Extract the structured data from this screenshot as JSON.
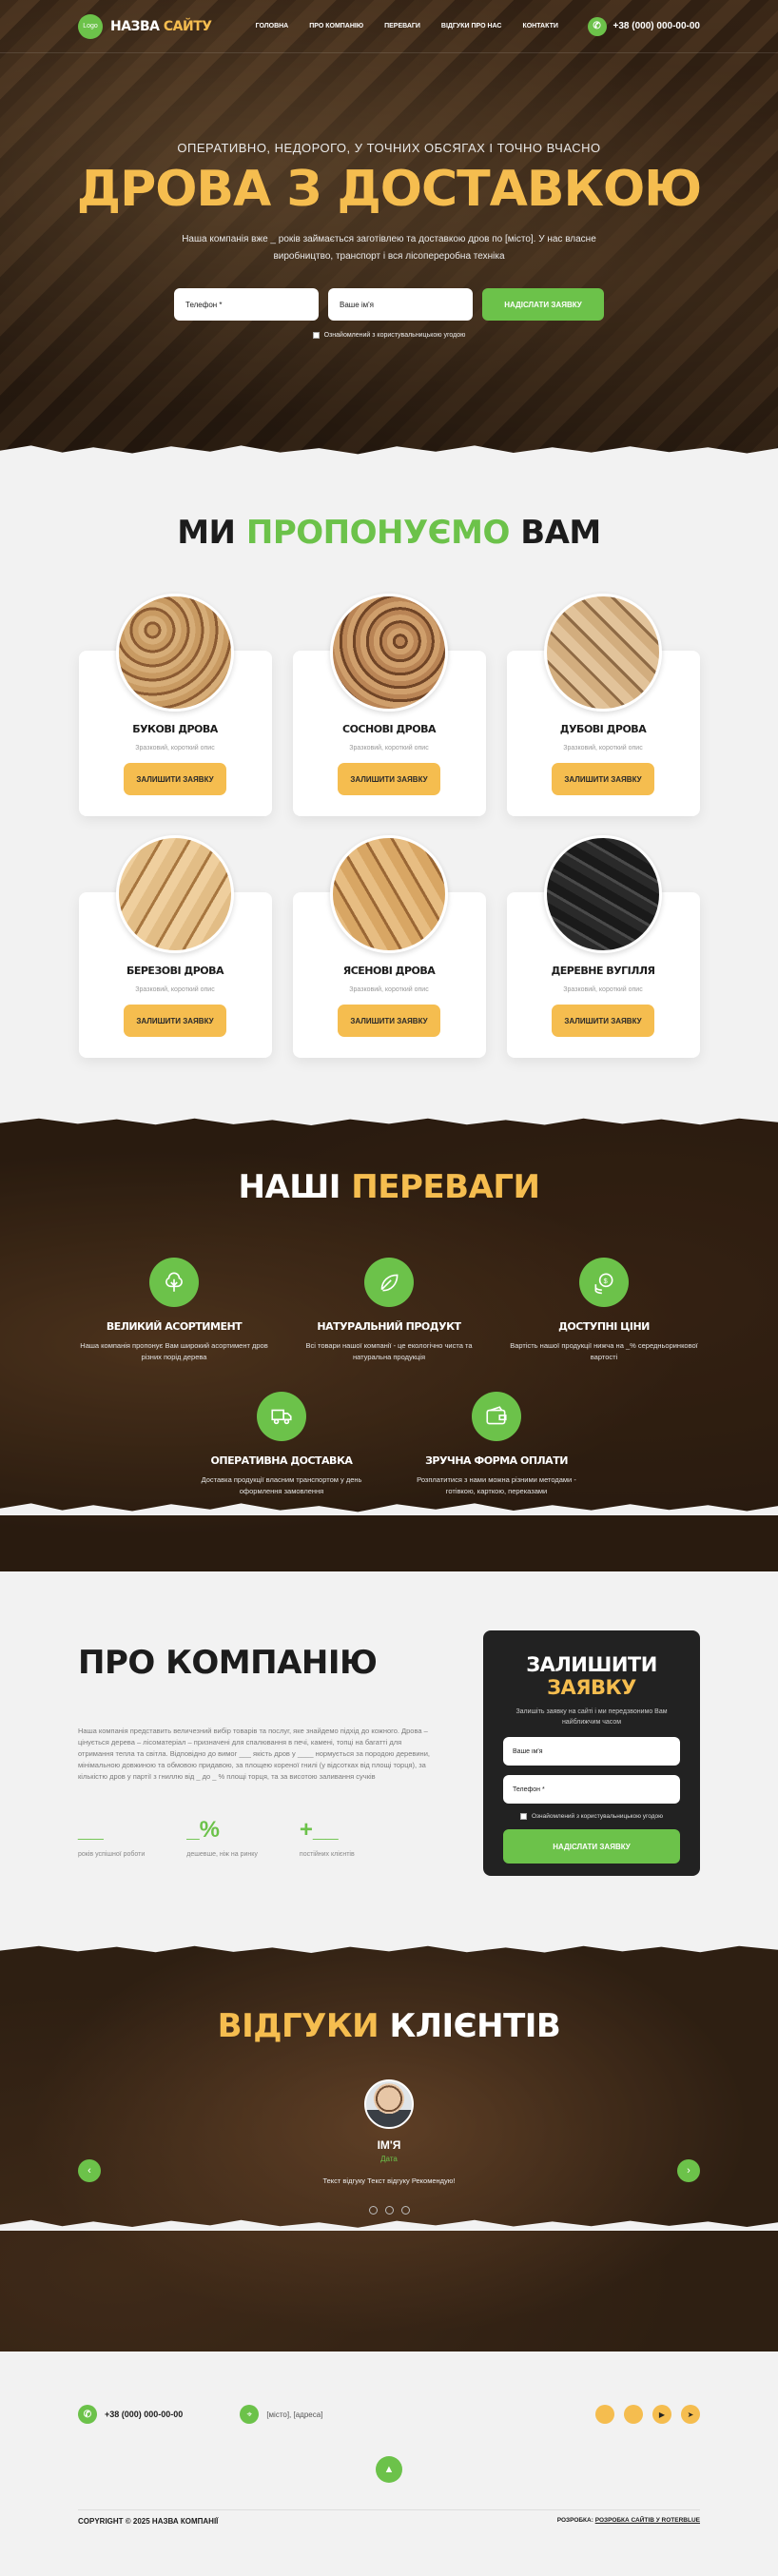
{
  "header": {
    "logo_text": "Logo",
    "site_name_1": "НАЗВА",
    "site_name_2": "САЙТУ",
    "menu": [
      "ГОЛОВНА",
      "ПРО КОМПАНІЮ",
      "ПЕРЕВАГИ",
      "ВІДГУКИ ПРО НАС",
      "КОНТАКТИ"
    ],
    "phone": "+38 (000) 000-00-00"
  },
  "hero": {
    "subtitle": "ОПЕРАТИВНО, НЕДОРОГО, У ТОЧНИХ ОБСЯГАХ І ТОЧНО ВЧАСНО",
    "title": "ДРОВА З ДОСТАВКОЮ",
    "text": "Наша компанія вже _ років займається заготівлею та доставкою дров по [місто]. У нас власне виробництво, транспорт і вся лісопереробна техніка",
    "phone_placeholder": "Телефон *",
    "name_placeholder": "Ваше ім'я",
    "submit": "НАДІСЛАТИ ЗАЯВКУ",
    "consent": "Ознайомлений з користувальницькою угодою"
  },
  "products": {
    "title_1": "МИ",
    "title_2": "ПРОПОНУЄМО",
    "title_3": "ВАМ",
    "items": [
      {
        "name": "БУКОВІ ДРОВА",
        "desc": "Зразковий, короткий опис",
        "button": "ЗАЛИШИТИ ЗАЯВКУ",
        "photo": "wood1"
      },
      {
        "name": "СОСНОВІ ДРОВА",
        "desc": "Зразковий, короткий опис",
        "button": "ЗАЛИШИТИ ЗАЯВКУ",
        "photo": "wood2"
      },
      {
        "name": "ДУБОВІ ДРОВА",
        "desc": "Зразковий, короткий опис",
        "button": "ЗАЛИШИТИ ЗАЯВКУ",
        "photo": "wood3"
      },
      {
        "name": "БЕРЕЗОВІ ДРОВА",
        "desc": "Зразковий, короткий опис",
        "button": "ЗАЛИШИТИ ЗАЯВКУ",
        "photo": "wood4"
      },
      {
        "name": "ЯСЕНОВІ ДРОВА",
        "desc": "Зразковий, короткий опис",
        "button": "ЗАЛИШИТИ ЗАЯВКУ",
        "photo": "wood5"
      },
      {
        "name": "ДЕРЕВНЕ ВУГІЛЛЯ",
        "desc": "Зразковий, короткий опис",
        "button": "ЗАЛИШИТИ ЗАЯВКУ",
        "photo": "coal"
      }
    ]
  },
  "advantages": {
    "title_1": "НАШІ",
    "title_2": "ПЕРЕВАГИ",
    "items": [
      {
        "title": "ВЕЛИКИЙ АСОРТИМЕНТ",
        "text": "Наша компанія пропонує Вам широкий асортимент дров різних порід дерева",
        "icon": "tree-icon"
      },
      {
        "title": "НАТУРАЛЬНИЙ ПРОДУКТ",
        "text": "Всі товари нашої компанії - це екологічно чиста та натуральна продукція",
        "icon": "leaf-icon"
      },
      {
        "title": "ДОСТУПНІ ЦІНИ",
        "text": "Вартість нашої продукції нижча на _% середньоринкової вартості",
        "icon": "coins-icon"
      },
      {
        "title": "ОПЕРАТИВНА ДОСТАВКА",
        "text": "Доставка продукції власним транспортом у день оформлення замовлення",
        "icon": "truck-icon"
      },
      {
        "title": "ЗРУЧНА ФОРМА ОПЛАТИ",
        "text": "Розплатитися з нами можна різними методами - готівкою, карткою, переказами",
        "icon": "wallet-icon"
      }
    ]
  },
  "about": {
    "title": "ПРО КОМПАНІЮ",
    "text": "Наша компанія представить величезний вибір товарів та послуг, яке знайдемо підхід до кожного. Дрова – цінується деревa – лісоматеріал – призначені для спалювання в печі, камені, топці на багатті для отримання тепла та світла. Відповідно до вимог ___ якість дров у ____ нормується за породою деревини, мінімальною довжиною та обмовою придавою, за площею кореної гнилі (у відсотках від площі торця), за кількістю дров у партії з гниллю від _ до _ % площі торця, та за висотою заливання сучків",
    "stats": [
      {
        "num": "__",
        "label": "років успішної роботи"
      },
      {
        "num": "_%",
        "label": "дешевше, ніж на ринку"
      },
      {
        "num": "+__",
        "label": "постійних клієнтів"
      }
    ]
  },
  "request_form": {
    "title_1": "ЗАЛИШИТИ",
    "title_2": "ЗАЯВКУ",
    "subtitle": "Залишіть заявку на сайті і ми передзвонимо Вам найближчим часом",
    "name_placeholder": "Ваше ім'я",
    "phone_placeholder": "Телефон *",
    "consent": "Ознайомлений з користувальницькою угодою",
    "submit": "НАДІСЛАТИ ЗАЯВКУ"
  },
  "reviews": {
    "title_1": "ВІДГУКИ",
    "title_2": "КЛІЄНТІВ",
    "name": "ІМ'Я",
    "date": "Дата",
    "text": "Текст відгуку Текст відгуку Рекомендую!",
    "prev": "‹",
    "next": "›"
  },
  "footer": {
    "phone": "+38 (000) 000-00-00",
    "address": "[місто], [адреса]",
    "copyright": "COPYRIGHT © 2025 НАЗВА КОМПАНІЇ",
    "dev_prefix": "РОЗРОБКА:",
    "dev_link": "РОЗРОБКА САЙТІВ У ROTERBLUE"
  },
  "colors": {
    "green": "#6cc24a",
    "yellow": "#f5bd4f",
    "dark": "#222222"
  }
}
